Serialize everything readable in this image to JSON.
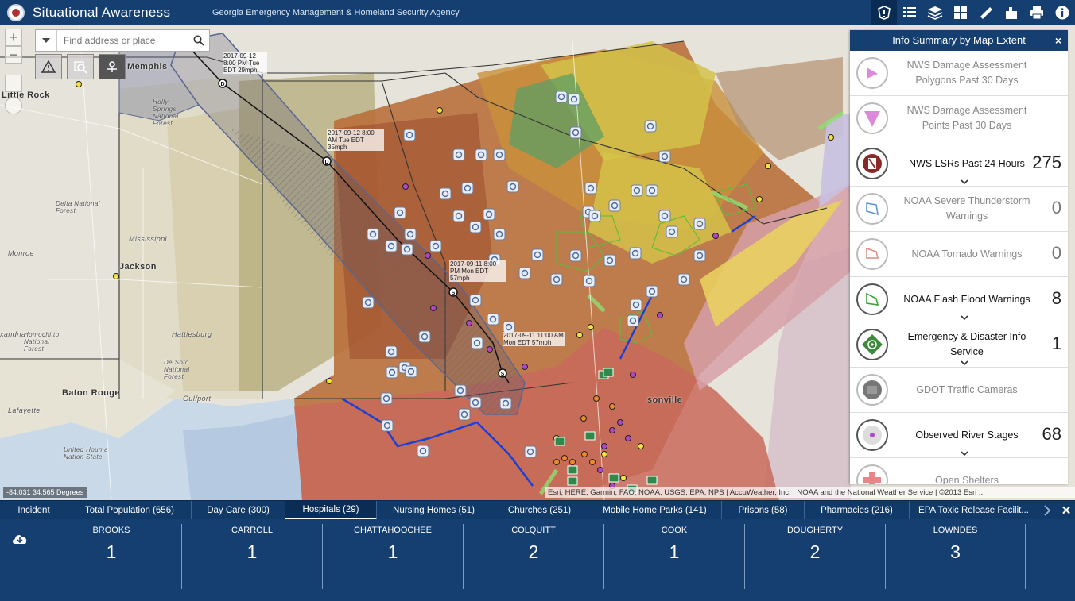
{
  "header": {
    "title": "Situational Awareness",
    "agency": "Georgia Emergency Management & Homeland Security Agency",
    "tools": [
      "layers-alert-icon",
      "legend-list-icon",
      "layers-icon",
      "basemap-grid-icon",
      "measure-ruler-icon",
      "bookmarks-icon",
      "print-icon",
      "info-icon"
    ]
  },
  "search": {
    "placeholder": "Find address or place"
  },
  "map": {
    "cities": {
      "memphis": "Memphis",
      "little_rock": "Little Rock",
      "jackson": "Jackson",
      "monroe": "Monroe",
      "baton_rouge": "Baton Rouge",
      "mississippi": "Mississippi",
      "hattiesburg": "Hattiesburg",
      "lafayette": "Lafayette",
      "gulfport": "Gulfport",
      "jacksonville": "sonville",
      "xandria": "xandria",
      "holly_springs": "Holly Springs National Forest",
      "homochitto": "Homochitto National Forest",
      "de_soto": "De Soto National Forest",
      "delta": "Delta National Forest",
      "houma": "United Houma Nation State"
    },
    "storm_labels": [
      "2017-09-12 8:00 PM Tue EDT 29mph",
      "2017-09-12 8:00 AM Tue EDT 35mph",
      "2017-09-11 8:00 PM Mon EDT 57mph",
      "2017-09-11 11:00 AM Mon EDT 57mph"
    ],
    "coordinates": "-84.031 34.565 Degrees",
    "attribution": "Esri, HERE, Garmin, FAO, NOAA, USGS, EPA, NPS | AccuWeather, Inc. | NOAA and the National Weather Service | ©2013 Esri ..."
  },
  "panel": {
    "title": "Info Summary by Map Extent",
    "rows": [
      {
        "label": "NWS Damage Assessment Polygons Past 30 Days",
        "count": ""
      },
      {
        "label": "NWS Damage Assessment Points Past 30 Days",
        "count": ""
      },
      {
        "label": "NWS LSRs Past 24 Hours",
        "count": "275"
      },
      {
        "label": "NOAA Severe Thunderstorm Warnings",
        "count": "0"
      },
      {
        "label": "NOAA Tornado Warnings",
        "count": "0"
      },
      {
        "label": "NOAA Flash Flood Warnings",
        "count": "8"
      },
      {
        "label": "Emergency & Disaster Info Service",
        "count": "1"
      },
      {
        "label": "GDOT Traffic Cameras",
        "count": ""
      },
      {
        "label": "Observed River Stages",
        "count": "68"
      },
      {
        "label": "Open Shelters",
        "count": ""
      }
    ]
  },
  "tabs": [
    "Incident",
    "Total Population (656)",
    "Day Care (300)",
    "Hospitals (29)",
    "Nursing Homes (51)",
    "Churches (251)",
    "Mobile Home Parks (141)",
    "Prisons (58)",
    "Pharmacies (216)",
    "EPA Toxic Release Facilit..."
  ],
  "active_tab": "Hospitals (29)",
  "stats": [
    {
      "name": "BROOKS",
      "value": "1"
    },
    {
      "name": "CARROLL",
      "value": "1"
    },
    {
      "name": "CHATTAHOOCHEE",
      "value": "1"
    },
    {
      "name": "COLQUITT",
      "value": "2"
    },
    {
      "name": "COOK",
      "value": "1"
    },
    {
      "name": "DOUGHERTY",
      "value": "2"
    },
    {
      "name": "LOWNDES",
      "value": "3"
    }
  ],
  "colors": {
    "header": "#153f70",
    "accent": "#0a2c55"
  }
}
